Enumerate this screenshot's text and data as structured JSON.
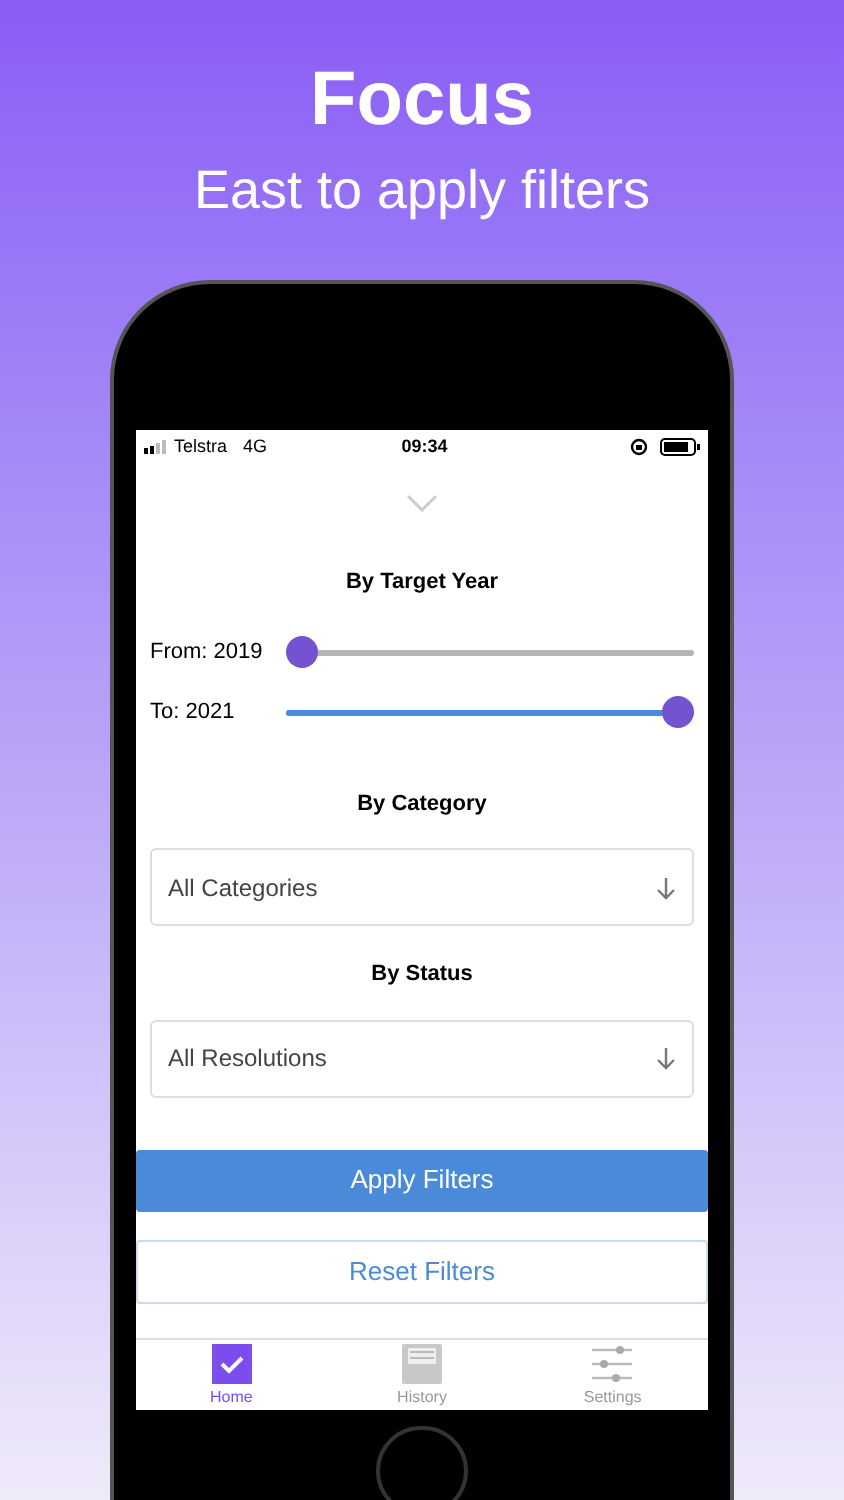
{
  "headline": {
    "title": "Focus",
    "subtitle": "East to apply filters"
  },
  "status_bar": {
    "carrier": "Telstra",
    "network": "4G",
    "time": "09:34"
  },
  "sections": [
    {
      "kind": "sliders",
      "title": "By Target Year",
      "sliders": [
        {
          "label": "From: 2019",
          "level": 0
        },
        {
          "label": "To: 2021",
          "level": 1
        }
      ]
    },
    {
      "kind": "dropdown",
      "title": "By Category",
      "value": "All Categories"
    },
    {
      "kind": "dropdown",
      "title": "By Status",
      "value": "All Resolutions"
    }
  ],
  "buttons": [
    {
      "kind": "primary",
      "label": "Apply Filters"
    },
    {
      "kind": "secondary",
      "label": "Reset Filters"
    }
  ],
  "tabs": [
    {
      "label": "Home",
      "kind": "check",
      "selected": true
    },
    {
      "label": "History",
      "kind": "tray",
      "selected": false
    },
    {
      "label": "Settings",
      "kind": "sliders",
      "selected": false
    }
  ]
}
